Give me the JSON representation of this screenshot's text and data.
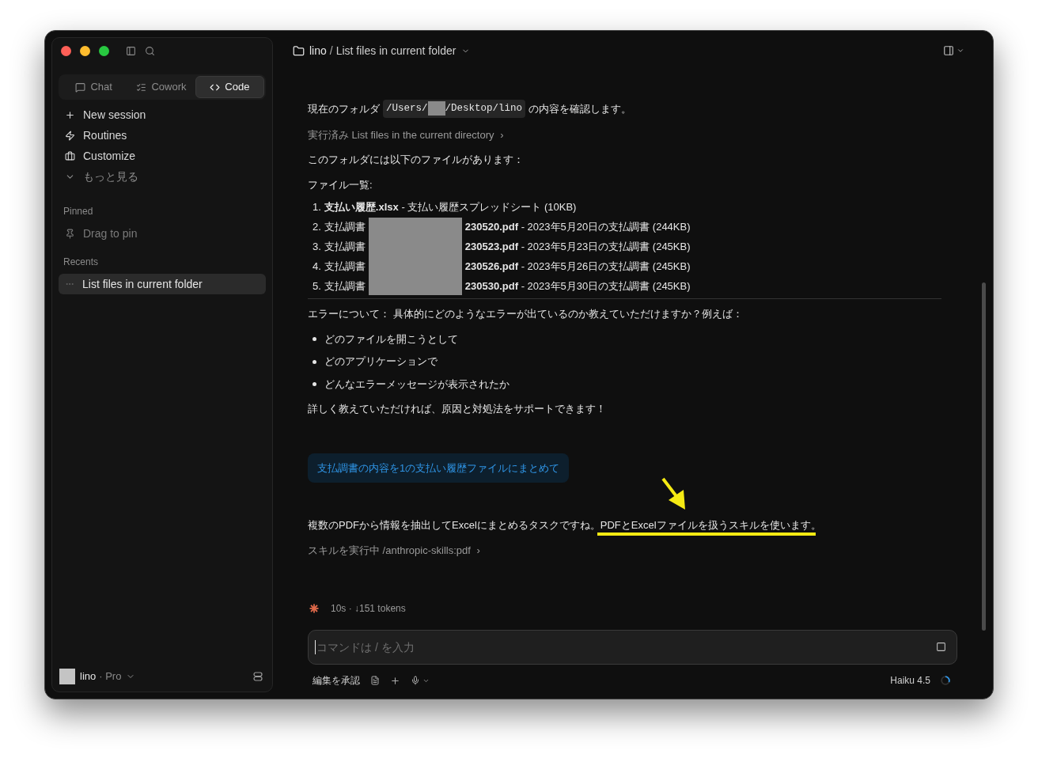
{
  "sidebar": {
    "tabs": [
      {
        "label": "Chat",
        "selected": false
      },
      {
        "label": "Cowork",
        "selected": false
      },
      {
        "label": "Code",
        "selected": true
      }
    ],
    "nav": [
      {
        "label": "New session",
        "muted": false
      },
      {
        "label": "Routines",
        "muted": false
      },
      {
        "label": "Customize",
        "muted": false
      },
      {
        "label": "もっと見る",
        "muted": true
      }
    ],
    "pinned": {
      "heading": "Pinned",
      "hint": "Drag to pin"
    },
    "recents": {
      "heading": "Recents",
      "items": [
        {
          "label": "List files in current folder",
          "selected": true
        }
      ]
    },
    "account": {
      "name": "lino",
      "plan": "· Pro"
    }
  },
  "header": {
    "folder": "lino",
    "separator": "/",
    "title": "List files in current folder"
  },
  "messages": [
    {
      "kind": "path",
      "before": "現在のフォルダ",
      "code_start": "/Users/",
      "code_end": "/Desktop/lino",
      "after": "の内容を確認します。"
    },
    {
      "kind": "tool",
      "text": "実行済み List files in the current directory",
      "chevron": "›"
    },
    {
      "kind": "text",
      "text": "このフォルダには以下のファイルがあります："
    },
    {
      "kind": "text",
      "text": "ファイル一覧:"
    },
    {
      "kind": "files",
      "items": [
        {
          "number": "1.",
          "name": "支払い履歴.xlsx",
          "description": " - 支払い履歴スプレッドシート (10KB)"
        },
        {
          "number": "2.",
          "prefix": "支払調書",
          "name": "230520.pdf",
          "description": " - 2023年5月20日の支払調書 (244KB)"
        },
        {
          "number": "3.",
          "prefix": "支払調書",
          "name": "230523.pdf",
          "description": " - 2023年5月23日の支払調書 (245KB)"
        },
        {
          "number": "4.",
          "prefix": "支払調書",
          "name": "230526.pdf",
          "description": " - 2023年5月26日の支払調書 (245KB)"
        },
        {
          "number": "5.",
          "prefix": "支払調書",
          "name": "230530.pdf",
          "description": " - 2023年5月30日の支払調書 (245KB)"
        }
      ]
    },
    {
      "kind": "rule"
    },
    {
      "kind": "text",
      "text": "エラーについて： 具体的にどのようなエラーが出ているのか教えていただけますか？例えば："
    },
    {
      "kind": "bullets",
      "items": [
        "どのファイルを開こうとして",
        "どのアプリケーションで",
        "どんなエラーメッセージが表示されたか"
      ]
    },
    {
      "kind": "text",
      "text": "詳しく教えていただければ、原因と対処法をサポートできます！"
    },
    {
      "kind": "user",
      "text": "支払調書の内容を1の支払い履歴ファイルにまとめて"
    },
    {
      "kind": "highlighted",
      "text": "複数のPDFから情報を抽出してExcelにまとめるタスクですね。",
      "highlight": "PDFとExcelファイルを扱うスキルを使います。"
    },
    {
      "kind": "tool",
      "text": "スキルを実行中 /anthropic-skills:pdf",
      "chevron": "›"
    }
  ],
  "status": {
    "text": "10s · ↓151 tokens"
  },
  "composer": {
    "placeholder": "コマンドは / を入力",
    "mode": "編集を承認",
    "model": "Haiku 4.5"
  }
}
